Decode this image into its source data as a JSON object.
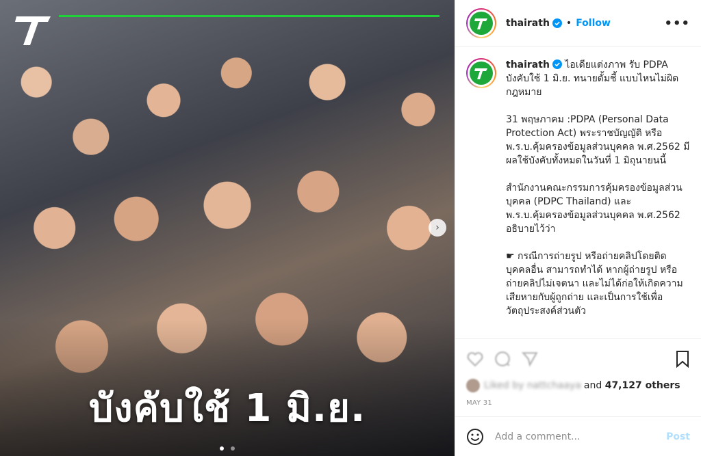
{
  "media": {
    "overlay_text": "บังคับใช้ 1 มิ.ย.",
    "dots_count": 2,
    "active_dot": 0
  },
  "header": {
    "username": "thairath",
    "separator": "•",
    "follow_label": "Follow",
    "more_label": "•••"
  },
  "caption": {
    "username": "thairath",
    "text": "ไอเดียแต่งภาพ รับ PDPA บังคับใช้ 1 มิ.ย. ทนายดั้มชี้ แบบไหนไม่ผิดกฎหมาย\n\n31 พฤษภาคม :PDPA (Personal Data Protection Act) พระราชบัญญัติ หรือ พ.ร.บ.คุ้มครองข้อมูลส่วนบุคคล พ.ศ.2562 มีผลใช้บังคับทั้งหมดในวันที่ 1 มิถุนายนนี้\n\nสำนักงานคณะกรรมการคุ้มครองข้อมูลส่วนบุคคล (PDPC Thailand) และ พ.ร.บ.คุ้มครองข้อมูลส่วนบุคคล พ.ศ.2562 อธิบายไว้ว่า\n\n☛ กรณีการถ่ายรูป หรือถ่ายคลิปโดยติดบุคคลอื่น สามารถทำได้ หากผู้ถ่ายรูป หรือถ่ายคลิปไม่เจตนา และไม่ได้ก่อให้เกิดความเสียหายกับผู้ถูกถ่าย และเป็นการใช้เพื่อวัตถุประสงค์ส่วนตัว"
  },
  "likes": {
    "liked_by": "Liked by nattchaaya",
    "and_label": "and",
    "count": "47,127 others"
  },
  "date": "MAY 31",
  "comment": {
    "placeholder": "Add a comment...",
    "post_label": "Post"
  },
  "colors": {
    "brand_green": "#1ea83a",
    "accent_line": "#1fd23a",
    "follow_blue": "#0095f6",
    "verified_blue": "#0095f6"
  },
  "icons": [
    "thairath-logo-icon",
    "verified-icon",
    "more-icon",
    "heart-icon",
    "comment-icon",
    "share-icon",
    "bookmark-icon",
    "emoji-icon",
    "chevron-right-icon"
  ]
}
